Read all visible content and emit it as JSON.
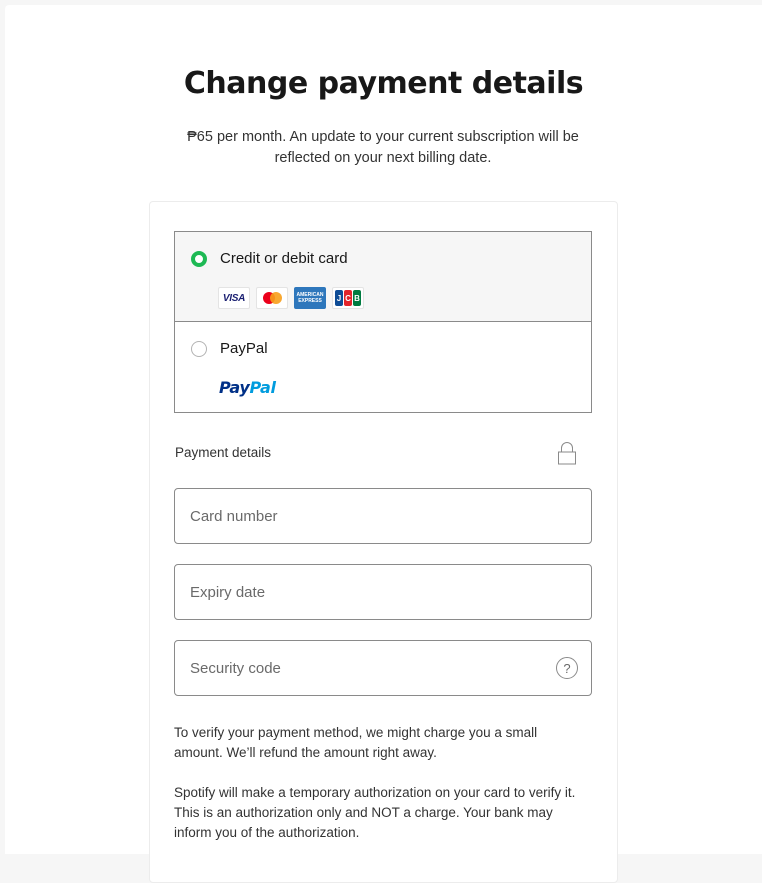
{
  "header": {
    "title": "Change payment details",
    "subtitle": "₱65 per month. An update to your current subscription will be reflected on your next billing date."
  },
  "payment_methods": [
    {
      "label": "Credit or debit card",
      "selected": true,
      "logos": {
        "visa": "VISA",
        "mastercard": "mastercard",
        "amex_line1": "AMERICAN",
        "amex_line2": "EXPRESS",
        "jcb": [
          "J",
          "C",
          "B"
        ]
      }
    },
    {
      "label": "PayPal",
      "selected": false,
      "logo_part1": "Pay",
      "logo_part2": "Pal"
    }
  ],
  "payment_details": {
    "label": "Payment details",
    "lock_icon": "lock-icon",
    "fields": [
      {
        "name": "card-number",
        "value": "",
        "placeholder": "Card number"
      },
      {
        "name": "expiry-date",
        "value": "",
        "placeholder": "Expiry date"
      },
      {
        "name": "security-code",
        "value": "",
        "placeholder": "Security code",
        "help_icon": "?"
      }
    ]
  },
  "notices": [
    "To verify your payment method, we might charge you a small amount. We’ll refund the amount right away.",
    "Spotify will make a temporary authorization on your card to verify it. This is an authorization only and NOT a charge. Your bank may inform you of the authorization."
  ],
  "colors": {
    "accent": "#1db954",
    "page_background": "#f6f6f6",
    "border": "#8a8a8a"
  }
}
